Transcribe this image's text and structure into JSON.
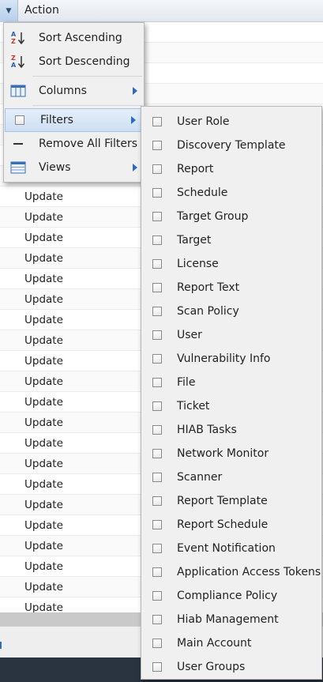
{
  "header": {
    "trigger_glyph": "▼",
    "label": "Action"
  },
  "grid": {
    "rows": [
      "",
      "",
      "",
      "",
      "",
      "",
      "",
      "",
      "Update",
      "Update",
      "Update",
      "Update",
      "Update",
      "Update",
      "Update",
      "Update",
      "Update",
      "Update",
      "Update",
      "Update",
      "Update",
      "Update",
      "Update",
      "Update",
      "Update",
      "Update",
      "Update",
      "Update",
      "Update",
      "Update",
      "Update"
    ]
  },
  "column_menu": {
    "sort_ascending": "Sort Ascending",
    "sort_descending": "Sort Descending",
    "columns": "Columns",
    "filters": "Filters",
    "remove_all_filters": "Remove All Filters",
    "views": "Views"
  },
  "filters": [
    "User Role",
    "Discovery Template",
    "Report",
    "Schedule",
    "Target Group",
    "Target",
    "License",
    "Report Text",
    "Scan Policy",
    "User",
    "Vulnerability Info",
    "File",
    "Ticket",
    "HIAB Tasks",
    "Network Monitor",
    "Scanner",
    "Report Template",
    "Report Schedule",
    "Event Notification",
    "Application Access Tokens",
    "Compliance Policy",
    "Hiab Management",
    "Main Account",
    "User Groups"
  ],
  "colors": {
    "accent": "#2b6bbf",
    "bottom_bar": "#2a3340",
    "menu_bg": "#f0f0f0",
    "active_item": "#cddff3"
  }
}
